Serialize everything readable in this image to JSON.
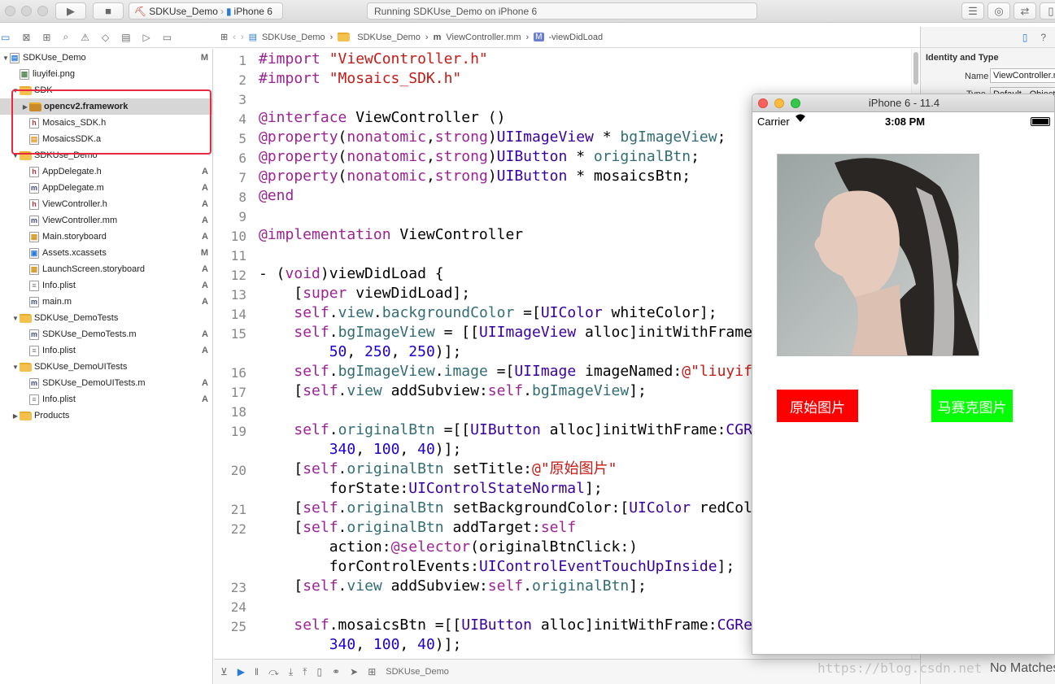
{
  "toolbar": {
    "scheme_target": "SDKUse_Demo",
    "scheme_device": "iPhone 6",
    "activity_status": "Running SDKUse_Demo on iPhone 6"
  },
  "navigator": {
    "items": [
      {
        "label": "SDKUse_Demo",
        "badge": "M",
        "kind": "project"
      },
      {
        "label": "liuyifei.png",
        "badge": "",
        "kind": "png"
      },
      {
        "label": "SDK",
        "badge": "",
        "kind": "folder"
      },
      {
        "label": "opencv2.framework",
        "badge": "",
        "kind": "framework"
      },
      {
        "label": "Mosaics_SDK.h",
        "badge": "",
        "kind": "h"
      },
      {
        "label": "MosaicsSDK.a",
        "badge": "",
        "kind": "a"
      },
      {
        "label": "SDKUse_Demo",
        "badge": "",
        "kind": "folder"
      },
      {
        "label": "AppDelegate.h",
        "badge": "A",
        "kind": "h"
      },
      {
        "label": "AppDelegate.m",
        "badge": "A",
        "kind": "m"
      },
      {
        "label": "ViewController.h",
        "badge": "A",
        "kind": "h"
      },
      {
        "label": "ViewController.mm",
        "badge": "A",
        "kind": "m"
      },
      {
        "label": "Main.storyboard",
        "badge": "A",
        "kind": "storyboard"
      },
      {
        "label": "Assets.xcassets",
        "badge": "M",
        "kind": "assets"
      },
      {
        "label": "LaunchScreen.storyboard",
        "badge": "A",
        "kind": "storyboard"
      },
      {
        "label": "Info.plist",
        "badge": "A",
        "kind": "plist"
      },
      {
        "label": "main.m",
        "badge": "A",
        "kind": "m"
      },
      {
        "label": "SDKUse_DemoTests",
        "badge": "",
        "kind": "folder"
      },
      {
        "label": "SDKUse_DemoTests.m",
        "badge": "A",
        "kind": "m"
      },
      {
        "label": "Info.plist",
        "badge": "A",
        "kind": "plist"
      },
      {
        "label": "SDKUse_DemoUITests",
        "badge": "",
        "kind": "folder"
      },
      {
        "label": "SDKUse_DemoUITests.m",
        "badge": "A",
        "kind": "m"
      },
      {
        "label": "Info.plist",
        "badge": "A",
        "kind": "plist"
      },
      {
        "label": "Products",
        "badge": "",
        "kind": "folder"
      }
    ]
  },
  "jumpbar": {
    "crumbs": [
      "SDKUse_Demo",
      "SDKUse_Demo",
      "ViewController.mm",
      "-viewDidLoad"
    ]
  },
  "editor": {
    "line_numbers": [
      "1",
      "2",
      "3",
      "4",
      "5",
      "6",
      "7",
      "8",
      "9",
      "10",
      "11",
      "12",
      "13",
      "14",
      "15",
      "",
      "16",
      "17",
      "18",
      "19",
      "",
      "20",
      "",
      "21",
      "22",
      "",
      "",
      "23",
      "24",
      "25",
      ""
    ],
    "lines": [
      "#import \"ViewController.h\"",
      "#import \"Mosaics_SDK.h\"",
      "",
      "@interface ViewController ()",
      "@property(nonatomic,strong)UIImageView * bgImageView;",
      "@property(nonatomic,strong)UIButton * originalBtn;",
      "@property(nonatomic,strong)UIButton * mosaicsBtn;",
      "@end",
      "",
      "@implementation ViewController",
      "",
      "- (void)viewDidLoad {",
      "    [super viewDidLoad];",
      "    self.view.backgroundColor =[UIColor whiteColor];",
      "    self.bgImageView = [[UIImageView alloc]initWithFrame:CGRectMake(",
      "        50, 250, 250)];",
      "    self.bgImageView.image =[UIImage imageNamed:@\"liuyifei\"];",
      "    [self.view addSubview:self.bgImageView];",
      "",
      "    self.originalBtn =[[UIButton alloc]initWithFrame:CGRectMake(",
      "        340, 100, 40)];",
      "    [self.originalBtn setTitle:@\"原始图片\"",
      "        forState:UIControlStateNormal];",
      "    [self.originalBtn setBackgroundColor:[UIColor redColor]];",
      "    [self.originalBtn addTarget:self",
      "        action:@selector(originalBtnClick:)",
      "        forControlEvents:UIControlEventTouchUpInside];",
      "    [self.view addSubview:self.originalBtn];",
      "",
      "    self.mosaicsBtn =[[UIButton alloc]initWithFrame:CGRectMake(",
      "        340, 100, 40)];"
    ]
  },
  "debugbar": {
    "target": "SDKUse_Demo"
  },
  "inspector": {
    "section_title": "Identity and Type",
    "name_label": "Name",
    "name_value": "ViewController.mm",
    "type_label": "Type",
    "type_value": "Default - Objective-C++",
    "no_matches": "No Matches"
  },
  "watermark": "https://blog.csdn.net",
  "simulator": {
    "title": "iPhone 6 - 11.4",
    "carrier": "Carrier",
    "time": "3:08 PM",
    "btn_original": "原始图片",
    "btn_mosaics": "马赛克图片",
    "colors": {
      "original": "#ff0000",
      "mosaics": "#00ff00"
    }
  }
}
